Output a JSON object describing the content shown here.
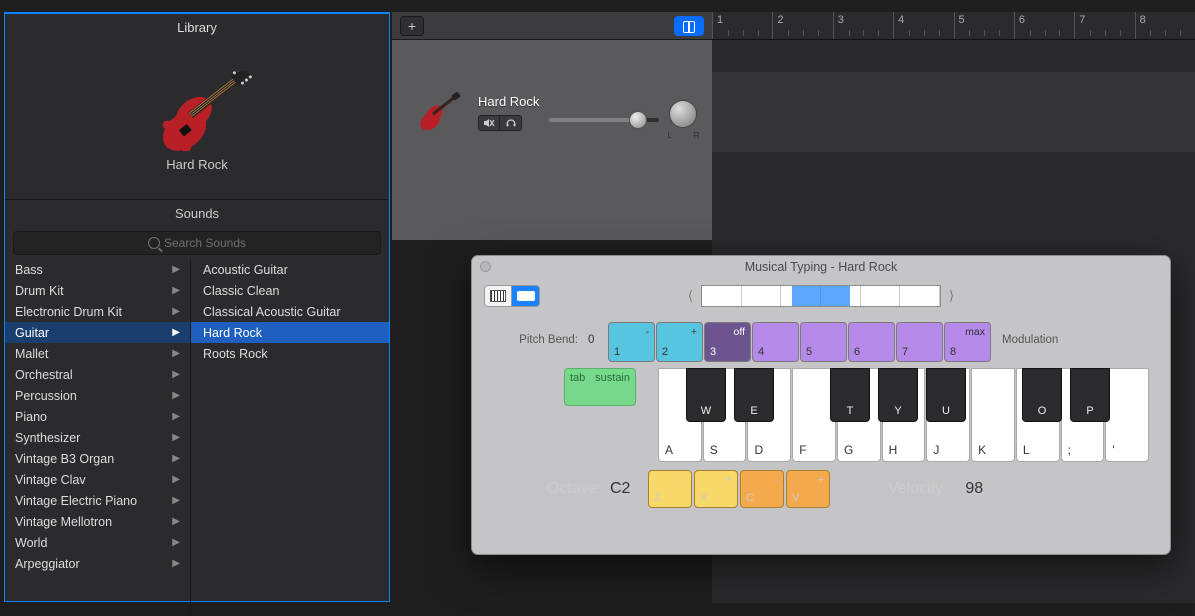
{
  "library": {
    "title": "Library",
    "preview_name": "Hard Rock",
    "sounds_title": "Sounds",
    "search_placeholder": "Search Sounds",
    "categories": [
      "Bass",
      "Drum Kit",
      "Electronic Drum Kit",
      "Guitar",
      "Mallet",
      "Orchestral",
      "Percussion",
      "Piano",
      "Synthesizer",
      "Vintage B3 Organ",
      "Vintage Clav",
      "Vintage Electric Piano",
      "Vintage Mellotron",
      "World",
      "Arpeggiator"
    ],
    "selected_category_index": 3,
    "patches": [
      "Acoustic Guitar",
      "Classic Clean",
      "Classical Acoustic Guitar",
      "Hard Rock",
      "Roots Rock"
    ],
    "selected_patch_index": 3
  },
  "track": {
    "name": "Hard Rock",
    "pan_left": "L",
    "pan_right": "R"
  },
  "timeline": {
    "bars": [
      "1",
      "2",
      "3",
      "4",
      "5",
      "6",
      "7",
      "8"
    ]
  },
  "mt": {
    "title": "Musical Typing - Hard Rock",
    "pitch_bend_label": "Pitch Bend:",
    "pitch_bend_value": "0",
    "modulation_label": "Modulation",
    "num_keys": [
      {
        "top": "-",
        "bottom": "1",
        "cls": "k-cyan"
      },
      {
        "top": "+",
        "bottom": "2",
        "cls": "k-cyan"
      },
      {
        "top": "off",
        "bottom": "3",
        "cls": "k-purple-dk"
      },
      {
        "top": "",
        "bottom": "4",
        "cls": "k-purple"
      },
      {
        "top": "",
        "bottom": "5",
        "cls": "k-purple"
      },
      {
        "top": "",
        "bottom": "6",
        "cls": "k-purple"
      },
      {
        "top": "",
        "bottom": "7",
        "cls": "k-purple"
      },
      {
        "top": "max",
        "bottom": "8",
        "cls": "k-purple"
      }
    ],
    "sustain_top": "sustain",
    "sustain_bottom": "tab",
    "white_keys": [
      "A",
      "S",
      "D",
      "F",
      "G",
      "H",
      "J",
      "K",
      "L",
      ";",
      "'"
    ],
    "black_keys": [
      {
        "lab": "W",
        "pos": 0
      },
      {
        "lab": "E",
        "pos": 1
      },
      {
        "lab": "T",
        "pos": 3
      },
      {
        "lab": "Y",
        "pos": 4
      },
      {
        "lab": "U",
        "pos": 5
      },
      {
        "lab": "O",
        "pos": 7
      },
      {
        "lab": "P",
        "pos": 8
      }
    ],
    "octave_label": "Octave:",
    "octave_value": "C2",
    "oct_keys": [
      {
        "top": "-",
        "bottom": "Z",
        "cls": "k-yellow"
      },
      {
        "top": "+",
        "bottom": "X",
        "cls": "k-yellow"
      },
      {
        "top": "-",
        "bottom": "C",
        "cls": "k-orange"
      },
      {
        "top": "+",
        "bottom": "V",
        "cls": "k-orange"
      }
    ],
    "velocity_label": "Velocity:",
    "velocity_value": "98"
  }
}
